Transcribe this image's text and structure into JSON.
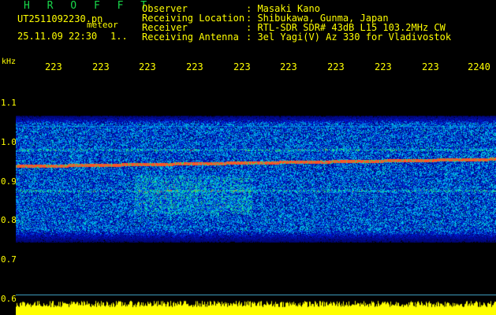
{
  "header": {
    "app_title": "H R O F F T",
    "filename": "UT2511092230.pn",
    "file_suffix": "meteor",
    "datetime": "25.11.09 22:30",
    "frame_indicator": "1.."
  },
  "info": [
    {
      "label": "Observer",
      "value": ": Masaki Kano"
    },
    {
      "label": "Receiving Location",
      "value": ": Shibukawa, Gunma, Japan"
    },
    {
      "label": "Receiver",
      "value": ": RTL-SDR SDR# 43dB L15 103.2MHz CW"
    },
    {
      "label": "Receiving Antenna",
      "value": ": 3el Yagi(V) Az 330 for Vladivostok"
    }
  ],
  "axis": {
    "unit": "kHz",
    "x_ticks": [
      "223",
      "223",
      "223",
      "223",
      "223",
      "223",
      "223",
      "223",
      "223",
      "2240"
    ],
    "y_ticks": [
      "1.1",
      "1.0",
      "0.9",
      "0.8",
      "0.7",
      "0.6"
    ]
  },
  "colors": {
    "text": "#ffff00",
    "title": "#19d84a",
    "background": "#000000"
  }
}
